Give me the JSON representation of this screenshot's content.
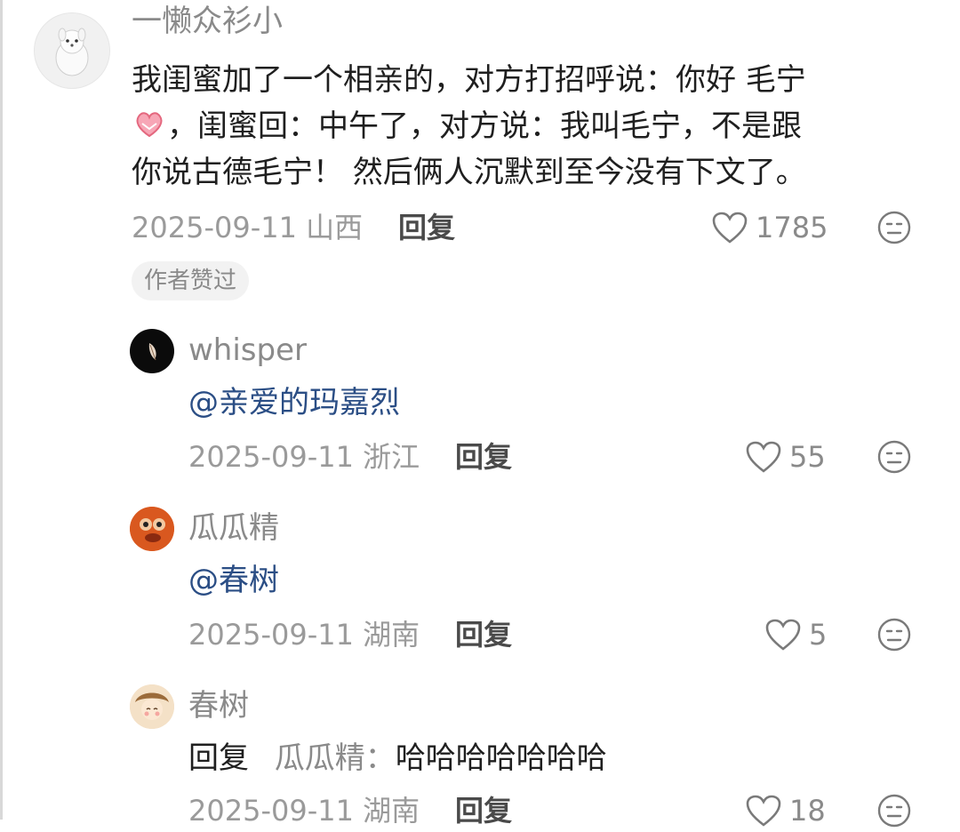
{
  "comments": [
    {
      "username": "一懒众衫小",
      "content": "我闺蜜加了一个相亲的，对方打招呼说：你好 毛宁",
      "content_line2": "，闺蜜回：中午了，对方说：我叫毛宁，不是跟",
      "content_line3": "你说古德毛宁！ 然后俩人沉默到至今没有下文了。",
      "date": "2025-09-11",
      "location": "山西",
      "reply_label": "回复",
      "likes": "1785",
      "badge": "作者赞过"
    }
  ],
  "replies": [
    {
      "username": "whisper",
      "mention": "@亲爱的玛嘉烈",
      "date": "2025-09-11",
      "location": "浙江",
      "reply_label": "回复",
      "likes": "55"
    },
    {
      "username": "瓜瓜精",
      "mention": "@春树",
      "date": "2025-09-11",
      "location": "湖南",
      "reply_label": "回复",
      "likes": "5"
    },
    {
      "username": "春树",
      "reply_prefix": "回复",
      "reply_target": "瓜瓜精：",
      "reply_text": "哈哈哈哈哈哈哈",
      "date": "2025-09-11",
      "location": "湖南",
      "reply_label": "回复",
      "likes": "18"
    }
  ],
  "icons": {
    "heart": "heart-icon",
    "dislike": "meh-face-icon",
    "handshake_emoji": "heart-hands-emoji"
  }
}
